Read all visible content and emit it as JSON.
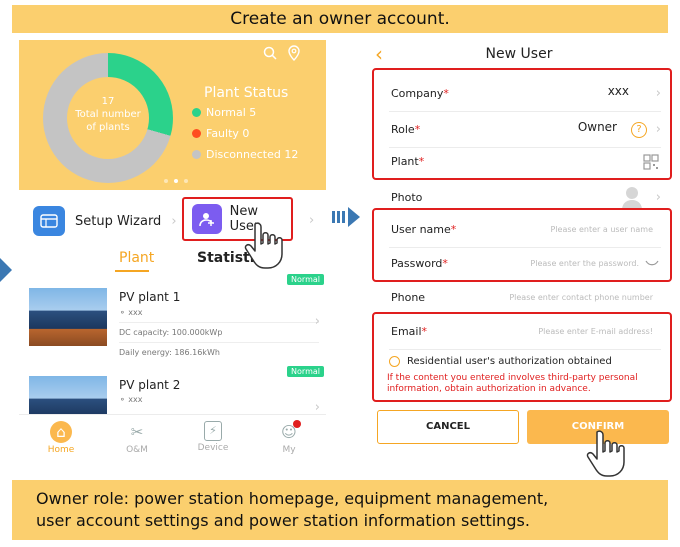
{
  "top_banner": "Create an owner account.",
  "bottom_banner": {
    "line1": "Owner role: power station homepage, equipment management,",
    "line2": "user account settings and power station information settings."
  },
  "left_app": {
    "donut": {
      "total": "17",
      "caption_line1": "Total number",
      "caption_line2": "of plants",
      "normal": 5,
      "faulty": 0,
      "disconnected": 12
    },
    "plant_status": {
      "title": "Plant Status",
      "normal": "Normal 5",
      "faulty": "Faulty 0",
      "disconnected": "Disconnected 12"
    },
    "setup_wizard": "Setup Wizard",
    "new_user": "New User",
    "tabs": [
      "Plant",
      "Statistics"
    ],
    "plants": [
      {
        "badge": "Normal",
        "name": "PV plant 1",
        "owner": "xxx",
        "capacity": "DC capacity: 100.000kWp",
        "energy": "Daily energy: 186.16kWh"
      },
      {
        "badge": "Normal",
        "name": "PV plant 2",
        "owner": "xxx"
      }
    ],
    "nav": [
      "Home",
      "O&M",
      "Device",
      "My"
    ]
  },
  "right_app": {
    "title": "New User",
    "company_label": "Company",
    "company_value": "xxx",
    "role_label": "Role",
    "role_value": "Owner",
    "plant_label": "Plant",
    "photo_label": "Photo",
    "username_label": "User name",
    "username_placeholder": "Please enter a user name",
    "password_label": "Password",
    "password_placeholder": "Please enter the password.",
    "phone_label": "Phone",
    "phone_placeholder": "Please enter contact phone number",
    "email_label": "Email",
    "email_placeholder": "Please enter E-mail address!",
    "authorization": "Residential user's authorization obtained",
    "warning": "If the content you entered involves third-party personal information, obtain authorization in advance.",
    "cancel": "CANCEL",
    "confirm": "CONFIRM"
  },
  "colors": {
    "banner": "#fbcf6e",
    "accent": "#f5a623",
    "highlight": "#e01e1e",
    "normal_green": "#2bd28b",
    "disconnected_grey": "#c4c4c4",
    "wizard_blue": "#3a86e0",
    "new_user_purple": "#7c5cf0"
  },
  "icons": [
    "search-icon",
    "location-icon",
    "setup-wizard-icon",
    "new-user-icon",
    "home-icon",
    "om-tools-icon",
    "device-icon",
    "my-profile-icon",
    "back-chevron-icon",
    "help-icon",
    "qr-scan-icon",
    "avatar-icon",
    "eye-icon",
    "pointing-hand-icon"
  ]
}
